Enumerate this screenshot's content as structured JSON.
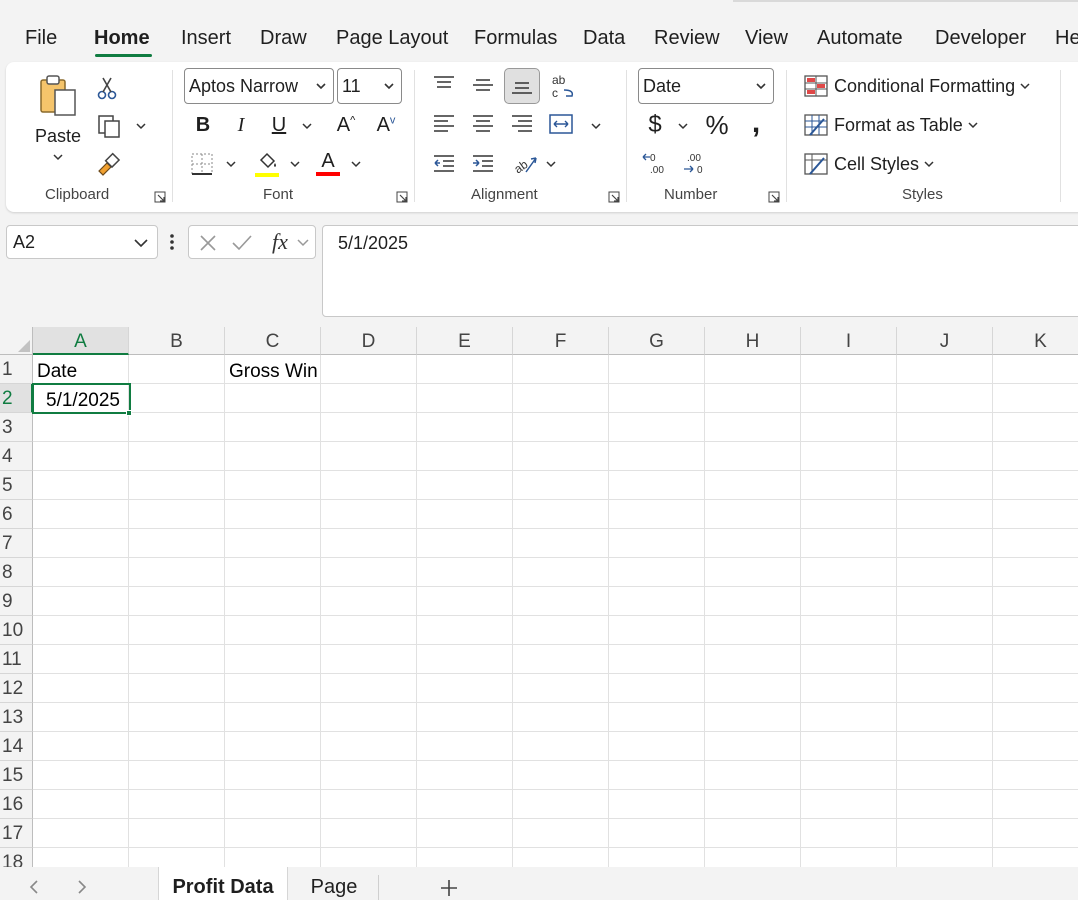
{
  "menu": {
    "tabs": [
      "File",
      "Home",
      "Insert",
      "Draw",
      "Page Layout",
      "Formulas",
      "Data",
      "Review",
      "View",
      "Automate",
      "Developer",
      "He"
    ],
    "active": "Home"
  },
  "ribbon": {
    "clipboard": {
      "paste_label": "Paste",
      "group_label": "Clipboard"
    },
    "font": {
      "font_name": "Aptos Narrow",
      "font_size": "11",
      "group_label": "Font",
      "highlight_color": "#ffff00",
      "font_color": "#ff0000"
    },
    "alignment": {
      "group_label": "Alignment"
    },
    "number": {
      "format": "Date",
      "group_label": "Number"
    },
    "styles": {
      "conditional_formatting": "Conditional Formatting",
      "format_as_table": "Format as Table",
      "cell_styles": "Cell Styles",
      "group_label": "Styles"
    }
  },
  "formula_bar": {
    "name_box": "A2",
    "formula": "5/1/2025"
  },
  "grid": {
    "columns": [
      "A",
      "B",
      "C",
      "D",
      "E",
      "F",
      "G",
      "H",
      "I",
      "J",
      "K"
    ],
    "rows": [
      "1",
      "2",
      "3",
      "4",
      "5",
      "6",
      "7",
      "8",
      "9",
      "10",
      "11",
      "12",
      "13",
      "14",
      "15",
      "16",
      "17",
      "18"
    ],
    "cells": {
      "A1": "Date",
      "C1": "Gross Win",
      "A2": "5/1/2025"
    },
    "selected_cell": "A2",
    "accent_color": "#107c41"
  },
  "sheets": {
    "tabs": [
      "Profit Data",
      "Page"
    ],
    "active": "Profit Data"
  }
}
